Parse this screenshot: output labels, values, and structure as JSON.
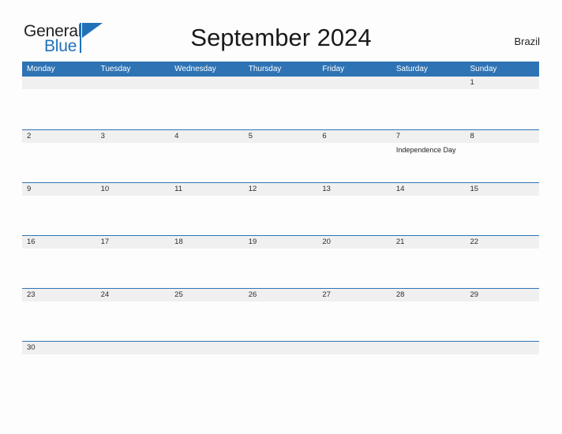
{
  "logo": {
    "word_top": "General",
    "word_bottom": "Blue",
    "flag_icon": "blue-triangle-flag",
    "brand_color": "#2071b8"
  },
  "header": {
    "title": "September 2024",
    "country": "Brazil"
  },
  "colors": {
    "header_blue": "#2e73b4",
    "row_divider_blue": "#2e73b4",
    "day_band_gray": "#f0f0f0",
    "page_background": "#fdfdfd",
    "text_dark": "#231f20"
  },
  "calendar": {
    "weekday_headers": [
      "Monday",
      "Tuesday",
      "Wednesday",
      "Thursday",
      "Friday",
      "Saturday",
      "Sunday"
    ],
    "weeks": [
      {
        "days": [
          {
            "num": "",
            "events": []
          },
          {
            "num": "",
            "events": []
          },
          {
            "num": "",
            "events": []
          },
          {
            "num": "",
            "events": []
          },
          {
            "num": "",
            "events": []
          },
          {
            "num": "",
            "events": []
          },
          {
            "num": "1",
            "events": []
          }
        ]
      },
      {
        "days": [
          {
            "num": "2",
            "events": []
          },
          {
            "num": "3",
            "events": []
          },
          {
            "num": "4",
            "events": []
          },
          {
            "num": "5",
            "events": []
          },
          {
            "num": "6",
            "events": []
          },
          {
            "num": "7",
            "events": [
              "Independence Day"
            ]
          },
          {
            "num": "8",
            "events": []
          }
        ]
      },
      {
        "days": [
          {
            "num": "9",
            "events": []
          },
          {
            "num": "10",
            "events": []
          },
          {
            "num": "11",
            "events": []
          },
          {
            "num": "12",
            "events": []
          },
          {
            "num": "13",
            "events": []
          },
          {
            "num": "14",
            "events": []
          },
          {
            "num": "15",
            "events": []
          }
        ]
      },
      {
        "days": [
          {
            "num": "16",
            "events": []
          },
          {
            "num": "17",
            "events": []
          },
          {
            "num": "18",
            "events": []
          },
          {
            "num": "19",
            "events": []
          },
          {
            "num": "20",
            "events": []
          },
          {
            "num": "21",
            "events": []
          },
          {
            "num": "22",
            "events": []
          }
        ]
      },
      {
        "days": [
          {
            "num": "23",
            "events": []
          },
          {
            "num": "24",
            "events": []
          },
          {
            "num": "25",
            "events": []
          },
          {
            "num": "26",
            "events": []
          },
          {
            "num": "27",
            "events": []
          },
          {
            "num": "28",
            "events": []
          },
          {
            "num": "29",
            "events": []
          }
        ]
      },
      {
        "days": [
          {
            "num": "30",
            "events": []
          },
          {
            "num": "",
            "events": []
          },
          {
            "num": "",
            "events": []
          },
          {
            "num": "",
            "events": []
          },
          {
            "num": "",
            "events": []
          },
          {
            "num": "",
            "events": []
          },
          {
            "num": "",
            "events": []
          }
        ]
      }
    ]
  }
}
